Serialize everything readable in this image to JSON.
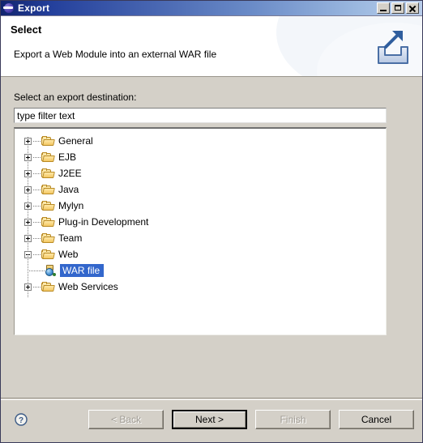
{
  "window": {
    "title": "Export",
    "title_icon": "eclipse-globe-icon",
    "controls": {
      "minimize": "minimize-icon",
      "maximize": "maximize-icon",
      "close": "close-icon"
    },
    "colors": {
      "titlebar_start": "#11246e",
      "titlebar_end": "#b9cdeb",
      "body": "#d4d0c8",
      "selection": "#3367cc",
      "folder": "#f3c762"
    }
  },
  "banner": {
    "title": "Select",
    "description": "Export a Web Module into an external WAR file",
    "icon": "export-arrow-icon"
  },
  "form": {
    "destination_label": "Select an export destination:",
    "filter": {
      "value": "type filter text",
      "placeholder": "type filter text"
    }
  },
  "tree": {
    "nodes": [
      {
        "label": "General",
        "icon": "folder-icon",
        "expanded": false,
        "level": 0,
        "selected": false
      },
      {
        "label": "EJB",
        "icon": "folder-icon",
        "expanded": false,
        "level": 0,
        "selected": false
      },
      {
        "label": "J2EE",
        "icon": "folder-icon",
        "expanded": false,
        "level": 0,
        "selected": false
      },
      {
        "label": "Java",
        "icon": "folder-icon",
        "expanded": false,
        "level": 0,
        "selected": false
      },
      {
        "label": "Mylyn",
        "icon": "folder-icon",
        "expanded": false,
        "level": 0,
        "selected": false
      },
      {
        "label": "Plug-in Development",
        "icon": "folder-icon",
        "expanded": false,
        "level": 0,
        "selected": false
      },
      {
        "label": "Team",
        "icon": "folder-icon",
        "expanded": false,
        "level": 0,
        "selected": false
      },
      {
        "label": "Web",
        "icon": "folder-icon",
        "expanded": true,
        "level": 0,
        "selected": false
      },
      {
        "label": "WAR file",
        "icon": "war-file-icon",
        "expanded": null,
        "level": 1,
        "selected": true
      },
      {
        "label": "Web Services",
        "icon": "folder-icon",
        "expanded": false,
        "level": 0,
        "selected": false
      }
    ]
  },
  "footer": {
    "help": "help-icon",
    "buttons": [
      {
        "label": "< Back",
        "state": "disabled"
      },
      {
        "label": "Next >",
        "state": "default"
      },
      {
        "label": "Finish",
        "state": "disabled"
      },
      {
        "label": "Cancel",
        "state": "enabled"
      }
    ]
  }
}
